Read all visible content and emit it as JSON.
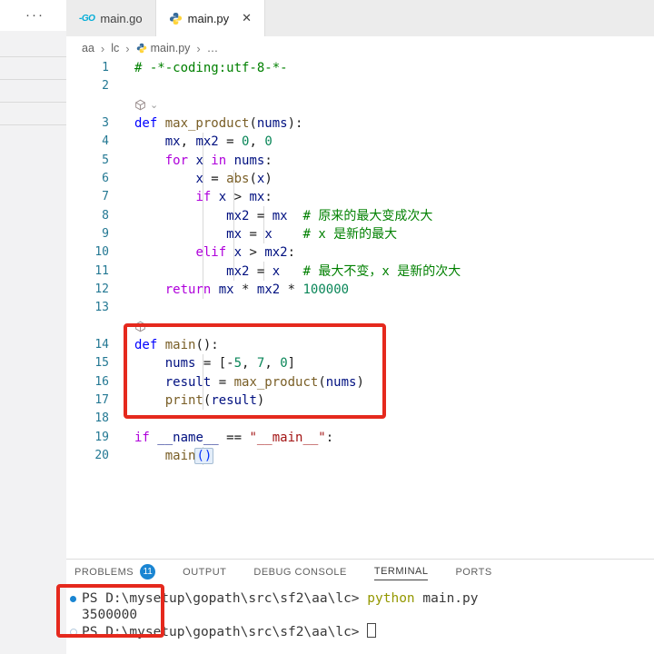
{
  "icons": {
    "more": "···",
    "close": "✕",
    "chevron_down": "⌄",
    "go_text": "-GO"
  },
  "colors": {
    "annotation_red": "#e5291d",
    "badge_blue": "#1a85d2",
    "terminal_command_yellow": "#949800",
    "line_number": "#237893"
  },
  "tabs": [
    {
      "label": "main.go",
      "icon": "go-file-icon",
      "active": false
    },
    {
      "label": "main.py",
      "icon": "python-file-icon",
      "active": true
    }
  ],
  "breadcrumb": {
    "items": {
      "0": "aa",
      "1": "lc",
      "2": "main.py",
      "3": "…"
    },
    "separator": "›"
  },
  "editor": {
    "decoration_icon": "cube-icon",
    "palette": {
      "kb": "#0000ff",
      "kc": "#af00db",
      "fn": "#795e26",
      "va": "#001080",
      "nu": "#098658",
      "st": "#a31515",
      "co": "#008000",
      "tx": "#1b1b1b",
      "bk": "#0431fa"
    },
    "lines": [
      {
        "n": "1",
        "segs": [
          [
            "co",
            "# -*-coding:utf-8-*-"
          ]
        ]
      },
      {
        "n": "2",
        "segs": []
      },
      {
        "icon": true,
        "chevron": true
      },
      {
        "n": "3",
        "segs": [
          [
            "kb",
            "def "
          ],
          [
            "fn",
            "max_product"
          ],
          [
            "tx",
            "("
          ],
          [
            "va",
            "nums"
          ],
          [
            "tx",
            "):"
          ]
        ]
      },
      {
        "n": "4",
        "segs": [
          [
            "tx",
            "    "
          ],
          [
            "va",
            "mx"
          ],
          [
            "tx",
            ", "
          ],
          [
            "va",
            "mx2"
          ],
          [
            "tx",
            " = "
          ],
          [
            "nu",
            "0"
          ],
          [
            "tx",
            ", "
          ],
          [
            "nu",
            "0"
          ]
        ]
      },
      {
        "n": "5",
        "segs": [
          [
            "tx",
            "    "
          ],
          [
            "kc",
            "for "
          ],
          [
            "va",
            "x"
          ],
          [
            "kc",
            " in "
          ],
          [
            "va",
            "nums"
          ],
          [
            "tx",
            ":"
          ]
        ]
      },
      {
        "n": "6",
        "segs": [
          [
            "tx",
            "        "
          ],
          [
            "va",
            "x"
          ],
          [
            "tx",
            " = "
          ],
          [
            "fn",
            "abs"
          ],
          [
            "tx",
            "("
          ],
          [
            "va",
            "x"
          ],
          [
            "tx",
            ")"
          ]
        ]
      },
      {
        "n": "7",
        "segs": [
          [
            "tx",
            "        "
          ],
          [
            "kc",
            "if "
          ],
          [
            "va",
            "x"
          ],
          [
            "tx",
            " > "
          ],
          [
            "va",
            "mx"
          ],
          [
            "tx",
            ":"
          ]
        ]
      },
      {
        "n": "8",
        "segs": [
          [
            "tx",
            "            "
          ],
          [
            "va",
            "mx2"
          ],
          [
            "tx",
            " = "
          ],
          [
            "va",
            "mx"
          ],
          [
            "co",
            "  # 原来的最大变成次大"
          ]
        ]
      },
      {
        "n": "9",
        "segs": [
          [
            "tx",
            "            "
          ],
          [
            "va",
            "mx"
          ],
          [
            "tx",
            " = "
          ],
          [
            "va",
            "x"
          ],
          [
            "co",
            "    # x 是新的最大"
          ]
        ]
      },
      {
        "n": "10",
        "segs": [
          [
            "tx",
            "        "
          ],
          [
            "kc",
            "elif "
          ],
          [
            "va",
            "x"
          ],
          [
            "tx",
            " > "
          ],
          [
            "va",
            "mx2"
          ],
          [
            "tx",
            ":"
          ]
        ]
      },
      {
        "n": "11",
        "segs": [
          [
            "tx",
            "            "
          ],
          [
            "va",
            "mx2"
          ],
          [
            "tx",
            " = "
          ],
          [
            "va",
            "x"
          ],
          [
            "co",
            "   # 最大不变，x 是新的次大"
          ]
        ]
      },
      {
        "n": "12",
        "segs": [
          [
            "tx",
            "    "
          ],
          [
            "kc",
            "return "
          ],
          [
            "va",
            "mx"
          ],
          [
            "tx",
            " * "
          ],
          [
            "va",
            "mx2"
          ],
          [
            "tx",
            " * "
          ],
          [
            "nu",
            "100000"
          ]
        ]
      },
      {
        "n": "13",
        "segs": []
      },
      {
        "icon": true,
        "chevron": false
      },
      {
        "n": "14",
        "segs": [
          [
            "kb",
            "def "
          ],
          [
            "fn",
            "main"
          ],
          [
            "tx",
            "():"
          ]
        ]
      },
      {
        "n": "15",
        "segs": [
          [
            "tx",
            "    "
          ],
          [
            "va",
            "nums"
          ],
          [
            "tx",
            " = ["
          ],
          [
            "tx",
            "-"
          ],
          [
            "nu",
            "5"
          ],
          [
            "tx",
            ", "
          ],
          [
            "nu",
            "7"
          ],
          [
            "tx",
            ", "
          ],
          [
            "nu",
            "0"
          ],
          [
            "tx",
            "]"
          ]
        ]
      },
      {
        "n": "16",
        "segs": [
          [
            "tx",
            "    "
          ],
          [
            "va",
            "result"
          ],
          [
            "tx",
            " = "
          ],
          [
            "fn",
            "max_product"
          ],
          [
            "tx",
            "("
          ],
          [
            "va",
            "nums"
          ],
          [
            "tx",
            ")"
          ]
        ]
      },
      {
        "n": "17",
        "segs": [
          [
            "tx",
            "    "
          ],
          [
            "fn",
            "print"
          ],
          [
            "tx",
            "("
          ],
          [
            "va",
            "result"
          ],
          [
            "tx",
            ")"
          ]
        ]
      },
      {
        "n": "18",
        "segs": []
      },
      {
        "n": "19",
        "segs": [
          [
            "kc",
            "if "
          ],
          [
            "va",
            "__name__"
          ],
          [
            "tx",
            " == "
          ],
          [
            "st",
            "\"__main__\""
          ],
          [
            "tx",
            ":"
          ]
        ]
      },
      {
        "n": "20",
        "segs": [
          [
            "tx",
            "    "
          ],
          [
            "fn",
            "main"
          ],
          [
            "bracket",
            "()"
          ]
        ]
      }
    ]
  },
  "panel": {
    "tabs": [
      {
        "label": "PROBLEMS",
        "active": false
      },
      {
        "label": "OUTPUT",
        "active": false
      },
      {
        "label": "DEBUG CONSOLE",
        "active": false
      },
      {
        "label": "TERMINAL",
        "active": true
      },
      {
        "label": "PORTS",
        "active": false
      }
    ],
    "problems_count": "11"
  },
  "terminal": {
    "prompt": "PS D:\\mysetup\\gopath\\src\\sf2\\aa\\lc> ",
    "cmd_python": "python ",
    "cmd_file": "main.py",
    "output": "3500000"
  }
}
